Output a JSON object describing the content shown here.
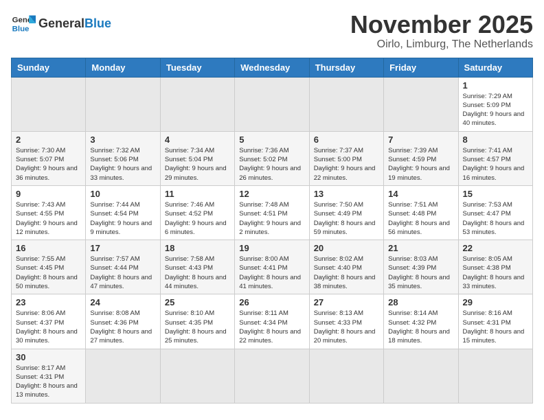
{
  "header": {
    "logo_general": "General",
    "logo_blue": "Blue",
    "month": "November 2025",
    "location": "Oirlo, Limburg, The Netherlands"
  },
  "weekdays": [
    "Sunday",
    "Monday",
    "Tuesday",
    "Wednesday",
    "Thursday",
    "Friday",
    "Saturday"
  ],
  "weeks": [
    [
      {
        "day": "",
        "info": ""
      },
      {
        "day": "",
        "info": ""
      },
      {
        "day": "",
        "info": ""
      },
      {
        "day": "",
        "info": ""
      },
      {
        "day": "",
        "info": ""
      },
      {
        "day": "",
        "info": ""
      },
      {
        "day": "1",
        "info": "Sunrise: 7:29 AM\nSunset: 5:09 PM\nDaylight: 9 hours and 40 minutes."
      }
    ],
    [
      {
        "day": "2",
        "info": "Sunrise: 7:30 AM\nSunset: 5:07 PM\nDaylight: 9 hours and 36 minutes."
      },
      {
        "day": "3",
        "info": "Sunrise: 7:32 AM\nSunset: 5:06 PM\nDaylight: 9 hours and 33 minutes."
      },
      {
        "day": "4",
        "info": "Sunrise: 7:34 AM\nSunset: 5:04 PM\nDaylight: 9 hours and 29 minutes."
      },
      {
        "day": "5",
        "info": "Sunrise: 7:36 AM\nSunset: 5:02 PM\nDaylight: 9 hours and 26 minutes."
      },
      {
        "day": "6",
        "info": "Sunrise: 7:37 AM\nSunset: 5:00 PM\nDaylight: 9 hours and 22 minutes."
      },
      {
        "day": "7",
        "info": "Sunrise: 7:39 AM\nSunset: 4:59 PM\nDaylight: 9 hours and 19 minutes."
      },
      {
        "day": "8",
        "info": "Sunrise: 7:41 AM\nSunset: 4:57 PM\nDaylight: 9 hours and 16 minutes."
      }
    ],
    [
      {
        "day": "9",
        "info": "Sunrise: 7:43 AM\nSunset: 4:55 PM\nDaylight: 9 hours and 12 minutes."
      },
      {
        "day": "10",
        "info": "Sunrise: 7:44 AM\nSunset: 4:54 PM\nDaylight: 9 hours and 9 minutes."
      },
      {
        "day": "11",
        "info": "Sunrise: 7:46 AM\nSunset: 4:52 PM\nDaylight: 9 hours and 6 minutes."
      },
      {
        "day": "12",
        "info": "Sunrise: 7:48 AM\nSunset: 4:51 PM\nDaylight: 9 hours and 2 minutes."
      },
      {
        "day": "13",
        "info": "Sunrise: 7:50 AM\nSunset: 4:49 PM\nDaylight: 8 hours and 59 minutes."
      },
      {
        "day": "14",
        "info": "Sunrise: 7:51 AM\nSunset: 4:48 PM\nDaylight: 8 hours and 56 minutes."
      },
      {
        "day": "15",
        "info": "Sunrise: 7:53 AM\nSunset: 4:47 PM\nDaylight: 8 hours and 53 minutes."
      }
    ],
    [
      {
        "day": "16",
        "info": "Sunrise: 7:55 AM\nSunset: 4:45 PM\nDaylight: 8 hours and 50 minutes."
      },
      {
        "day": "17",
        "info": "Sunrise: 7:57 AM\nSunset: 4:44 PM\nDaylight: 8 hours and 47 minutes."
      },
      {
        "day": "18",
        "info": "Sunrise: 7:58 AM\nSunset: 4:43 PM\nDaylight: 8 hours and 44 minutes."
      },
      {
        "day": "19",
        "info": "Sunrise: 8:00 AM\nSunset: 4:41 PM\nDaylight: 8 hours and 41 minutes."
      },
      {
        "day": "20",
        "info": "Sunrise: 8:02 AM\nSunset: 4:40 PM\nDaylight: 8 hours and 38 minutes."
      },
      {
        "day": "21",
        "info": "Sunrise: 8:03 AM\nSunset: 4:39 PM\nDaylight: 8 hours and 35 minutes."
      },
      {
        "day": "22",
        "info": "Sunrise: 8:05 AM\nSunset: 4:38 PM\nDaylight: 8 hours and 33 minutes."
      }
    ],
    [
      {
        "day": "23",
        "info": "Sunrise: 8:06 AM\nSunset: 4:37 PM\nDaylight: 8 hours and 30 minutes."
      },
      {
        "day": "24",
        "info": "Sunrise: 8:08 AM\nSunset: 4:36 PM\nDaylight: 8 hours and 27 minutes."
      },
      {
        "day": "25",
        "info": "Sunrise: 8:10 AM\nSunset: 4:35 PM\nDaylight: 8 hours and 25 minutes."
      },
      {
        "day": "26",
        "info": "Sunrise: 8:11 AM\nSunset: 4:34 PM\nDaylight: 8 hours and 22 minutes."
      },
      {
        "day": "27",
        "info": "Sunrise: 8:13 AM\nSunset: 4:33 PM\nDaylight: 8 hours and 20 minutes."
      },
      {
        "day": "28",
        "info": "Sunrise: 8:14 AM\nSunset: 4:32 PM\nDaylight: 8 hours and 18 minutes."
      },
      {
        "day": "29",
        "info": "Sunrise: 8:16 AM\nSunset: 4:31 PM\nDaylight: 8 hours and 15 minutes."
      }
    ],
    [
      {
        "day": "30",
        "info": "Sunrise: 8:17 AM\nSunset: 4:31 PM\nDaylight: 8 hours and 13 minutes."
      },
      {
        "day": "",
        "info": ""
      },
      {
        "day": "",
        "info": ""
      },
      {
        "day": "",
        "info": ""
      },
      {
        "day": "",
        "info": ""
      },
      {
        "day": "",
        "info": ""
      },
      {
        "day": "",
        "info": ""
      }
    ]
  ]
}
